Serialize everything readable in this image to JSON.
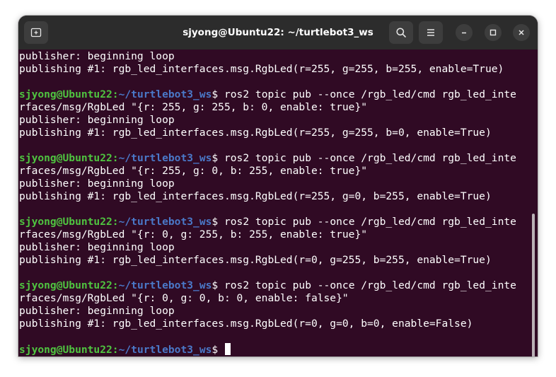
{
  "window": {
    "title": "sjyong@Ubuntu22: ~/turtlebot3_ws"
  },
  "prompt": {
    "user": "sjyong@Ubuntu22",
    "separator": ":",
    "path": "~/turtlebot3_ws",
    "symbol": "$"
  },
  "terminal": {
    "lines": [
      {
        "type": "output",
        "text": "publisher: beginning loop"
      },
      {
        "type": "output",
        "text": "publishing #1: rgb_led_interfaces.msg.RgbLed(r=255, g=255, b=255, enable=True)"
      },
      {
        "type": "blank",
        "text": ""
      },
      {
        "type": "command",
        "text": " ros2 topic pub --once /rgb_led/cmd rgb_led_inte"
      },
      {
        "type": "output",
        "text": "rfaces/msg/RgbLed \"{r: 255, g: 255, b: 0, enable: true}\""
      },
      {
        "type": "output",
        "text": "publisher: beginning loop"
      },
      {
        "type": "output",
        "text": "publishing #1: rgb_led_interfaces.msg.RgbLed(r=255, g=255, b=0, enable=True)"
      },
      {
        "type": "blank",
        "text": ""
      },
      {
        "type": "command",
        "text": " ros2 topic pub --once /rgb_led/cmd rgb_led_inte"
      },
      {
        "type": "output",
        "text": "rfaces/msg/RgbLed \"{r: 255, g: 0, b: 255, enable: true}\""
      },
      {
        "type": "output",
        "text": "publisher: beginning loop"
      },
      {
        "type": "output",
        "text": "publishing #1: rgb_led_interfaces.msg.RgbLed(r=255, g=0, b=255, enable=True)"
      },
      {
        "type": "blank",
        "text": ""
      },
      {
        "type": "command",
        "text": " ros2 topic pub --once /rgb_led/cmd rgb_led_inte"
      },
      {
        "type": "output",
        "text": "rfaces/msg/RgbLed \"{r: 0, g: 255, b: 255, enable: true}\""
      },
      {
        "type": "output",
        "text": "publisher: beginning loop"
      },
      {
        "type": "output",
        "text": "publishing #1: rgb_led_interfaces.msg.RgbLed(r=0, g=255, b=255, enable=True)"
      },
      {
        "type": "blank",
        "text": ""
      },
      {
        "type": "command",
        "text": " ros2 topic pub --once /rgb_led/cmd rgb_led_inte"
      },
      {
        "type": "output",
        "text": "rfaces/msg/RgbLed \"{r: 0, g: 0, b: 0, enable: false}\""
      },
      {
        "type": "output",
        "text": "publisher: beginning loop"
      },
      {
        "type": "output",
        "text": "publishing #1: rgb_led_interfaces.msg.RgbLed(r=0, g=0, b=0, enable=False)"
      },
      {
        "type": "blank",
        "text": ""
      },
      {
        "type": "prompt",
        "text": " "
      }
    ]
  },
  "icons": {
    "new_tab": "new-tab-icon",
    "search": "search-icon",
    "menu": "hamburger-menu-icon",
    "minimize": "minimize-icon",
    "maximize": "maximize-icon",
    "close": "close-icon"
  },
  "colors": {
    "terminal_bg": "#300a24",
    "titlebar_bg": "#2c2c2c",
    "prompt_user": "#4fc440",
    "prompt_path": "#4a78c8",
    "text": "#ffffff"
  }
}
